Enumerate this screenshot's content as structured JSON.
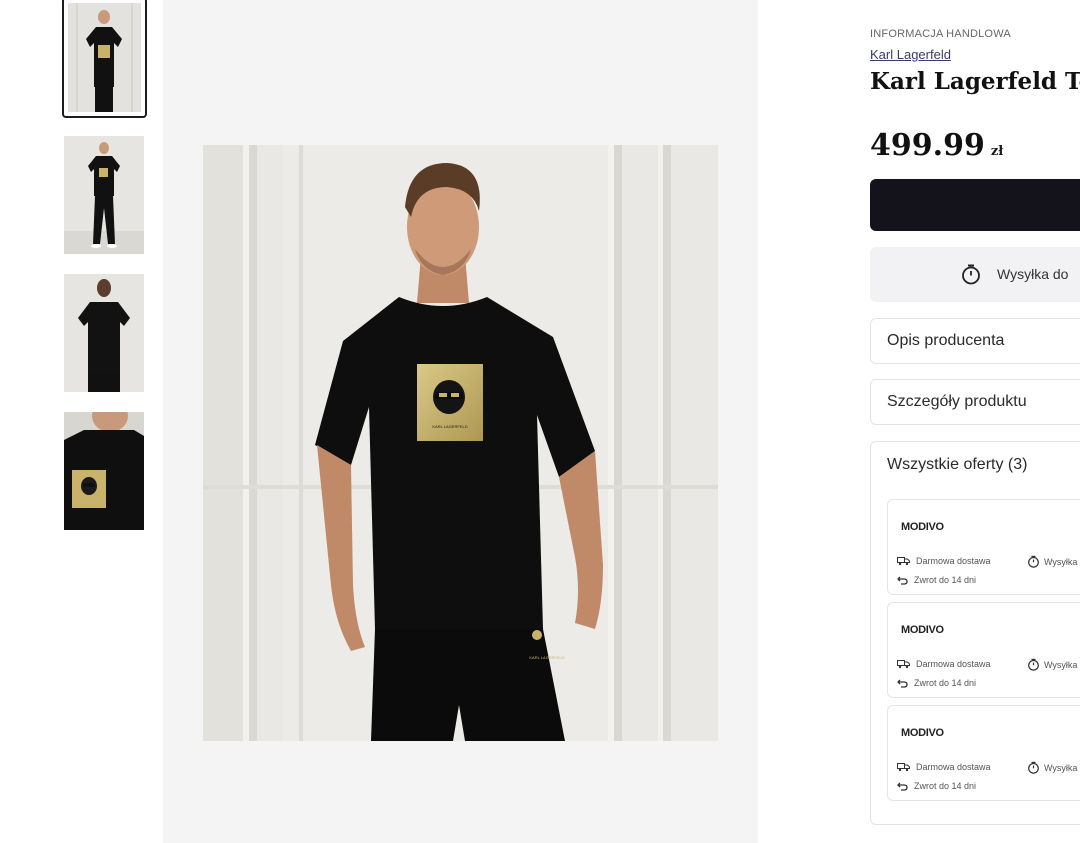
{
  "gallery": {
    "thumbnails": [
      {
        "label": "Product photo 1 - front",
        "active": true
      },
      {
        "label": "Product photo 2 - full body",
        "active": false
      },
      {
        "label": "Product photo 3 - back",
        "active": false
      },
      {
        "label": "Product photo 4 - detail",
        "active": false
      }
    ],
    "main_photo_alt": "Man wearing black t-shirt with gold Karl print",
    "print_text": "KARL LAGERFELD",
    "trousers_text": "KARL LAGERFELD"
  },
  "product": {
    "info_label": "INFORMACJA HANDLOWA",
    "brand": "Karl Lagerfeld",
    "title": "Karl Lagerfeld T-sh",
    "price": "499.99",
    "currency": "zł",
    "shipping_text": "Wysyłka do"
  },
  "accordions": {
    "producer": "Opis producenta",
    "details": "Szczegóły produktu",
    "offers": "Wszystkie oferty (3)"
  },
  "offers": [
    {
      "seller": "MODIVO",
      "delivery": "Darmowa dostawa",
      "shipping": "Wysyłka",
      "returns": "Zwrot do 14 dni"
    },
    {
      "seller": "MODIVO",
      "delivery": "Darmowa dostawa",
      "shipping": "Wysyłka",
      "returns": "Zwrot do 14 dni"
    },
    {
      "seller": "MODIVO",
      "delivery": "Darmowa dostawa",
      "shipping": "Wysyłka",
      "returns": "Zwrot do 14 dni"
    }
  ],
  "colors": {
    "tshirt": "#0e0e0e",
    "gold_print": "#c9b36a",
    "button": "#14131c",
    "brand_link": "#3b3a6b"
  }
}
